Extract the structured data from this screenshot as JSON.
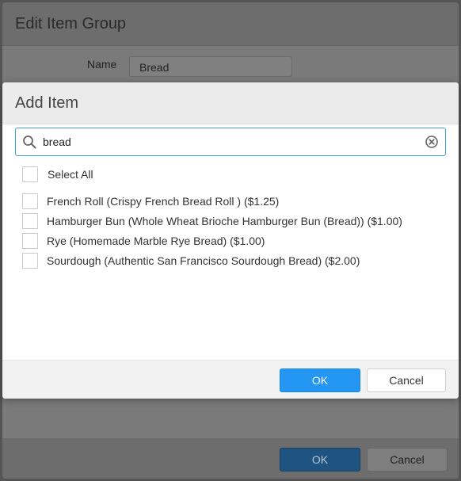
{
  "background_dialog": {
    "title": "Edit Item Group",
    "name_label": "Name",
    "name_value": "Bread",
    "ok_label": "OK",
    "cancel_label": "Cancel"
  },
  "dialog": {
    "title": "Add Item",
    "search": {
      "value": "bread",
      "icon": "search-icon",
      "clear_icon": "clear-icon"
    },
    "select_all_label": "Select All",
    "items": [
      {
        "label": "French Roll (Crispy French Bread Roll ) ($1.25)",
        "checked": false
      },
      {
        "label": "Hamburger Bun (Whole Wheat Brioche Hamburger Bun (Bread)) ($1.00)",
        "checked": false
      },
      {
        "label": "Rye (Homemade Marble Rye Bread) ($1.00)",
        "checked": false
      },
      {
        "label": "Sourdough (Authentic San Francisco Sourdough Bread) ($2.00)",
        "checked": false
      }
    ],
    "ok_label": "OK",
    "cancel_label": "Cancel"
  },
  "colors": {
    "accent": "#2496f3",
    "focus_border": "#3da2d6"
  }
}
